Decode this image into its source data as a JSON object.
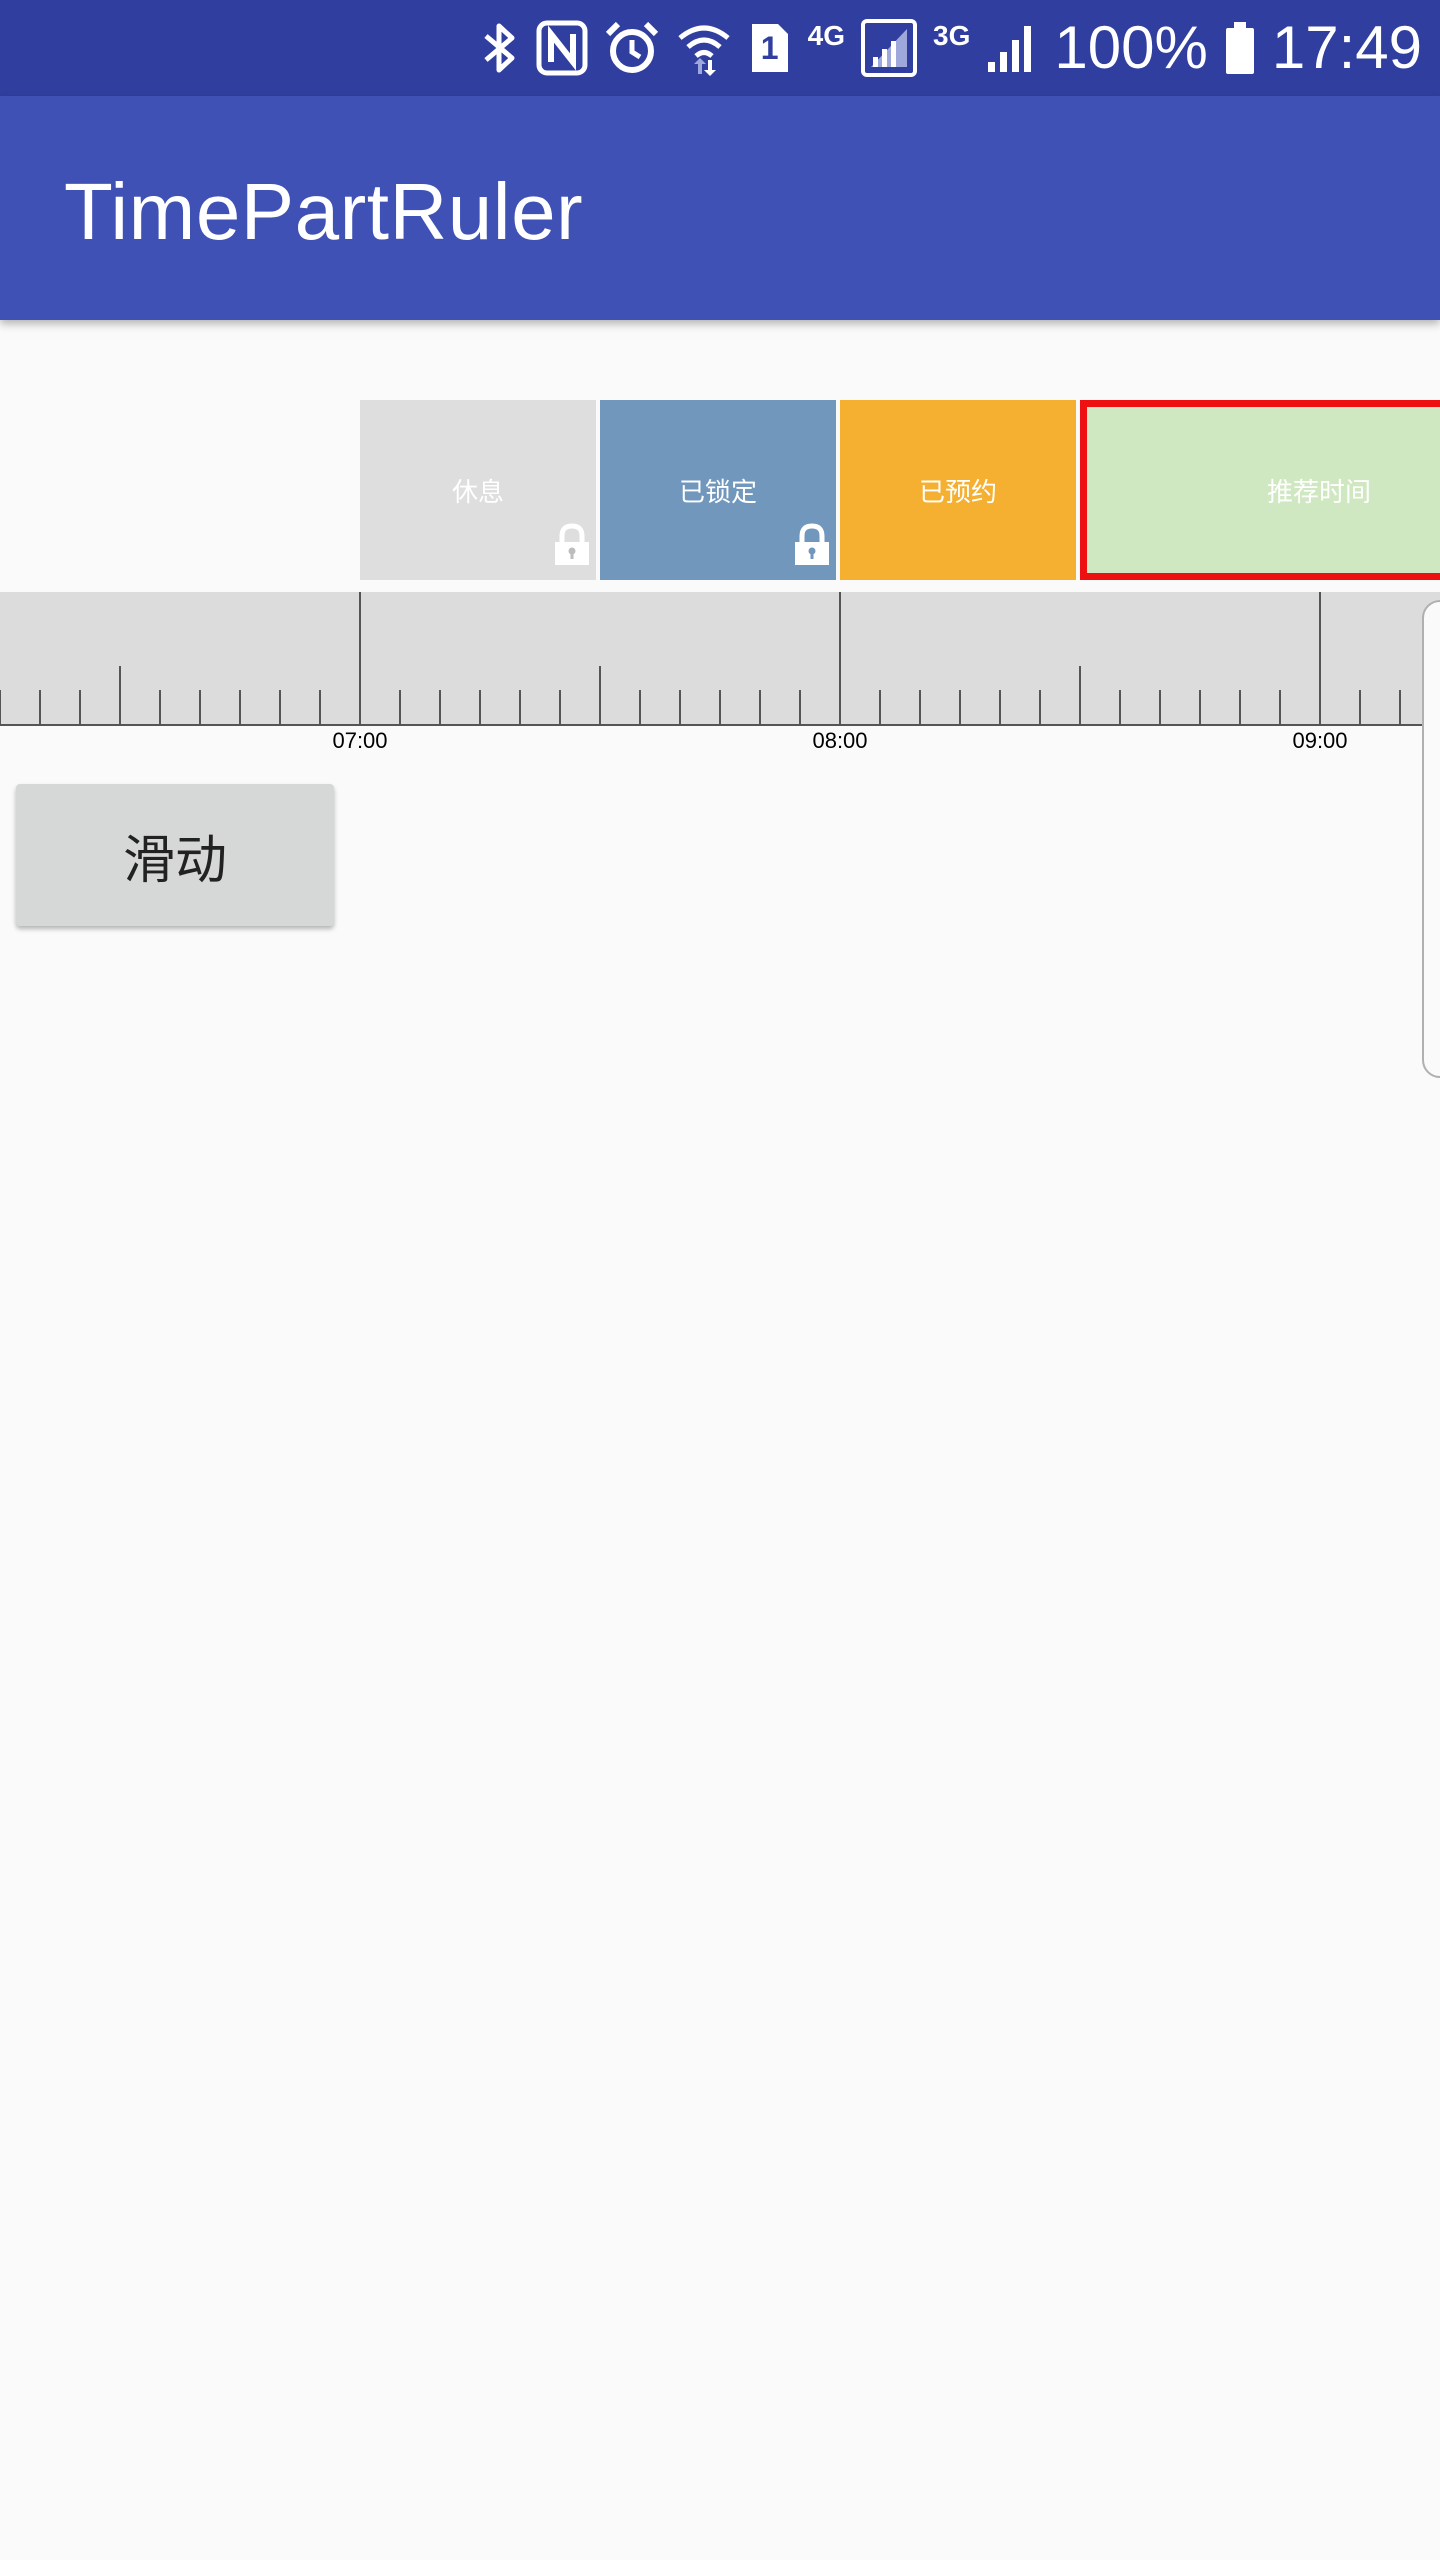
{
  "status_bar": {
    "network_4g": "4G",
    "network_3g": "3G",
    "sim_number": "1",
    "battery": "100%",
    "time": "17:49",
    "icons": [
      "bluetooth-icon",
      "nfc-icon",
      "alarm-icon",
      "wifi-icon",
      "sim-icon",
      "signal-icon",
      "battery-icon"
    ]
  },
  "app_bar": {
    "title": "TimePartRuler"
  },
  "timeline": {
    "parts": [
      {
        "label": "休息",
        "color": "#dedede",
        "locked": true
      },
      {
        "label": "已锁定",
        "color": "#7297bd",
        "locked": true
      },
      {
        "label": "已预约",
        "color": "#f5b031",
        "locked": false
      },
      {
        "label": "推荐时间",
        "color": "#d0e8c1",
        "locked": false,
        "highlight_color": "#ee1111"
      }
    ],
    "ruler": {
      "labels": [
        "07:00",
        "08:00",
        "09:00"
      ],
      "background": "#dcdcdc"
    }
  },
  "actions": {
    "slide_label": "滑动"
  }
}
